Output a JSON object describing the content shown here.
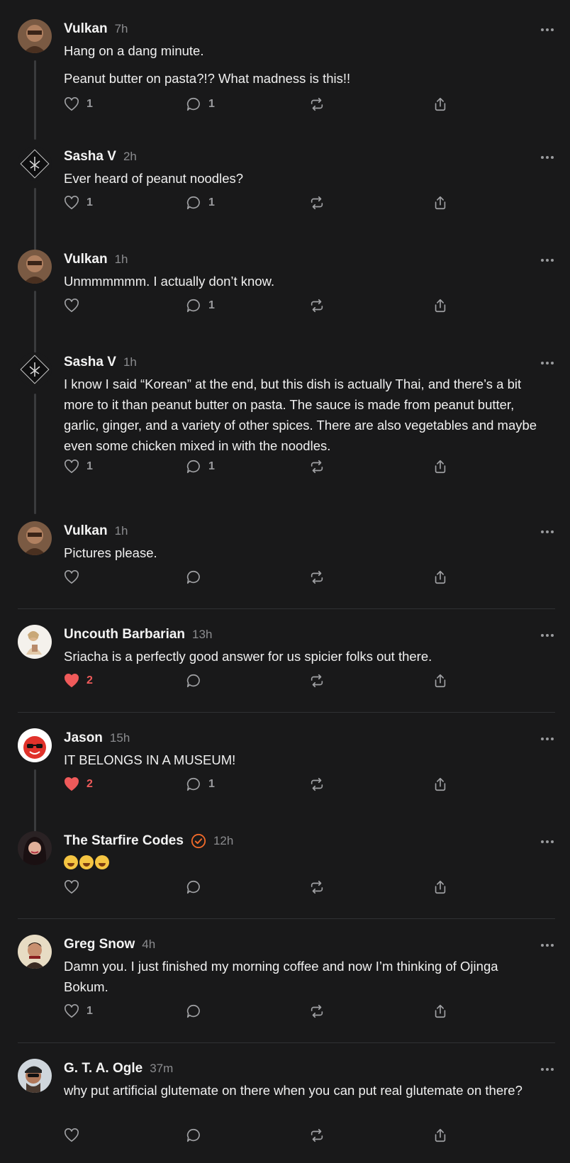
{
  "comments": [
    {
      "author": "Vulkan",
      "time": "7h",
      "paragraphs": [
        "Hang on a dang minute.",
        "Peanut butter on pasta?!? What madness is this!!"
      ],
      "likes": "1",
      "liked": false,
      "replies": "1"
    },
    {
      "author": "Sasha V",
      "time": "2h",
      "paragraphs": [
        "Ever heard of peanut noodles?"
      ],
      "likes": "1",
      "liked": false,
      "replies": "1"
    },
    {
      "author": "Vulkan",
      "time": "1h",
      "paragraphs": [
        "Unmmmmmm. I actually don’t know."
      ],
      "likes": "",
      "liked": false,
      "replies": "1"
    },
    {
      "author": "Sasha V",
      "time": "1h",
      "paragraphs": [
        "I know I said “Korean” at the end, but this dish is actually Thai, and there’s a bit more to it than peanut butter on pasta. The sauce is made from peanut butter, garlic, ginger, and a variety of other spices. There are also vegetables and maybe even some chicken mixed in with the noodles."
      ],
      "likes": "1",
      "liked": false,
      "replies": "1"
    },
    {
      "author": "Vulkan",
      "time": "1h",
      "paragraphs": [
        "Pictures please."
      ],
      "likes": "",
      "liked": false,
      "replies": ""
    },
    {
      "author": "Uncouth Barbarian",
      "time": "13h",
      "paragraphs": [
        "Sriacha is a perfectly good answer for us spicier folks out there."
      ],
      "likes": "2",
      "liked": true,
      "replies": ""
    },
    {
      "author": "Jason",
      "time": "15h",
      "paragraphs": [
        "IT BELONGS IN A MUSEUM!"
      ],
      "likes": "2",
      "liked": true,
      "replies": "1"
    },
    {
      "author": "The Starfire Codes",
      "time": "12h",
      "paragraphs": [
        ""
      ],
      "emoji": "🤣🤣🤣",
      "verified": true,
      "likes": "",
      "liked": false,
      "replies": ""
    },
    {
      "author": "Greg Snow",
      "time": "4h",
      "paragraphs": [
        "Damn you. I just finished my morning coffee and now I’m thinking of Ojinga Bokum."
      ],
      "likes": "1",
      "liked": false,
      "replies": ""
    },
    {
      "author": "G. T. A. Ogle",
      "time": "37m",
      "paragraphs": [
        "why put artificial glutemate on there when you can put real glutemate on there?"
      ],
      "likes": "",
      "liked": false,
      "replies": ""
    }
  ],
  "icons": {
    "like": "heart-icon",
    "reply": "speech-bubble-icon",
    "repost": "repost-icon",
    "share": "share-icon",
    "more": "more-options-icon",
    "verified": "verified-badge-icon"
  },
  "colors": {
    "background": "#19191a",
    "like_active": "#ef5a5a",
    "verified": "#f06a2a",
    "muted": "#9a9b9e"
  }
}
